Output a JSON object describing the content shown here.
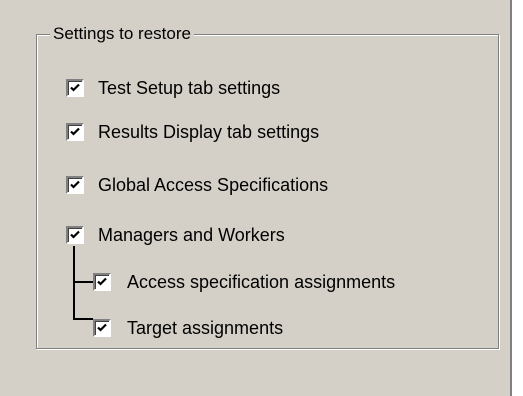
{
  "group": {
    "legend": "Settings to restore"
  },
  "options": [
    {
      "label": "Test Setup tab settings",
      "checked": true
    },
    {
      "label": "Results Display tab settings",
      "checked": true
    },
    {
      "label": "Global Access Specifications",
      "checked": true
    },
    {
      "label": "Managers and Workers",
      "checked": true
    },
    {
      "label": "Access specification assignments",
      "checked": true
    },
    {
      "label": "Target assignments",
      "checked": true
    }
  ],
  "colors": {
    "face": "#d4d0c8",
    "shadow": "#808080",
    "highlight": "#ffffff"
  }
}
